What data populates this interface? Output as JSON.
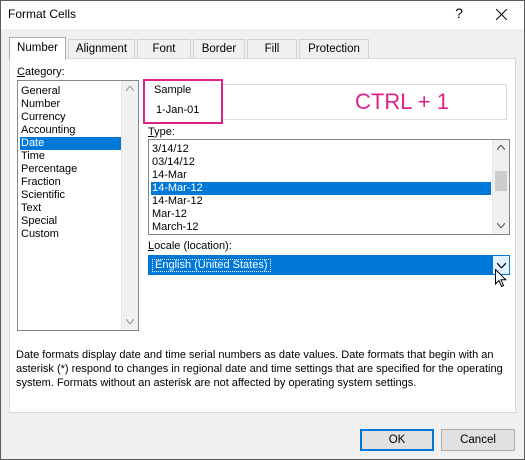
{
  "window": {
    "title": "Format Cells",
    "help_glyph": "?",
    "close_icon": "close-icon"
  },
  "tabs": [
    {
      "label": "Number",
      "active": true
    },
    {
      "label": "Alignment",
      "active": false
    },
    {
      "label": "Font",
      "active": false
    },
    {
      "label": "Border",
      "active": false
    },
    {
      "label": "Fill",
      "active": false
    },
    {
      "label": "Protection",
      "active": false
    }
  ],
  "category": {
    "label_underlined": "C",
    "label_rest": "ategory:",
    "items": [
      "General",
      "Number",
      "Currency",
      "Accounting",
      "Date",
      "Time",
      "Percentage",
      "Fraction",
      "Scientific",
      "Text",
      "Special",
      "Custom"
    ],
    "selected": "Date"
  },
  "sample": {
    "label": "Sample",
    "value": "1-Jan-01"
  },
  "annotation": {
    "text": "CTRL + 1",
    "color": "#e0218a"
  },
  "type": {
    "label_underlined": "T",
    "label_rest": "ype:",
    "items": [
      "3/14/12",
      "03/14/12",
      "14-Mar",
      "14-Mar-12",
      "14-Mar-12",
      "Mar-12",
      "March-12"
    ],
    "selected_index": 3
  },
  "locale": {
    "label_underlined": "L",
    "label_rest": "ocale (location):",
    "value": "English (United States)"
  },
  "description": "Date formats display date and time serial numbers as date values.  Date formats that begin with an asterisk (*) respond to changes in regional date and time settings that are specified for the operating system. Formats without an asterisk are not affected by operating system settings.",
  "buttons": {
    "ok": "OK",
    "cancel": "Cancel"
  },
  "colors": {
    "selection": "#0078d7",
    "highlight": "#e0218a"
  }
}
